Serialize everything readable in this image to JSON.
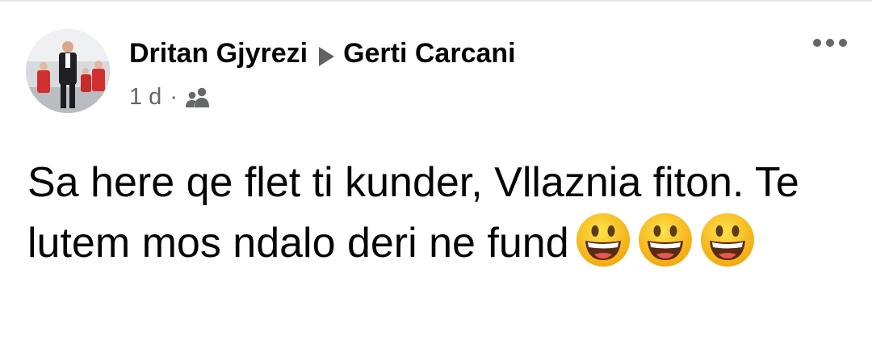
{
  "post": {
    "author": "Dritan Gjyrezi",
    "arrow_icon": "triangle-right-icon",
    "recipient": "Gerti Carcani",
    "time": "1 d",
    "separator": "·",
    "audience_icon": "friends-icon",
    "more_icon": "more-horizontal-icon",
    "text": "Sa here qe flet ti kunder, Vllaznia fiton. Te lutem mos ndalo deri ne fund",
    "emojis": [
      "grinning-face-icon",
      "grinning-face-icon",
      "grinning-face-icon"
    ]
  },
  "colors": {
    "primary_text": "#050505",
    "secondary_text": "#65676b",
    "emoji_yellow": "#f7c21e"
  }
}
